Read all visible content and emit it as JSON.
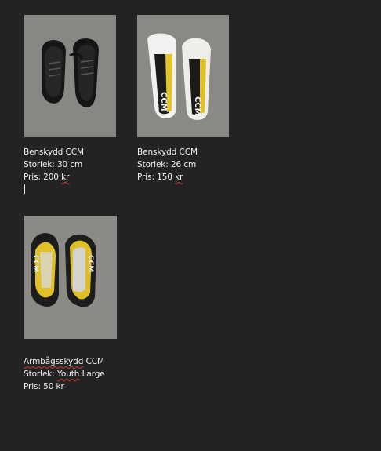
{
  "colors": {
    "page_background": "#232323",
    "text": "#f2f2f2",
    "spellcheck_underline": "#d23b3b"
  },
  "items": [
    {
      "image_subject": "black-ccm-shin-guards-photo",
      "name_word": "Benskydd",
      "name_brand": "CCM",
      "size_prefix": "Storlek:",
      "size_value": "30 cm",
      "price_prefix": "Pris: 200",
      "price_unit": "kr"
    },
    {
      "image_subject": "white-yellow-ccm-shin-guards-photo",
      "name_word": "Benskydd",
      "name_brand": "CCM",
      "size_prefix": "Storlek:",
      "size_value": "26 cm",
      "price_prefix": "Pris: 150",
      "price_unit": "kr"
    },
    {
      "image_subject": "ccm-elbow-pads-photo",
      "name_word": "Armbågsskydd",
      "name_brand": "CCM",
      "size_prefix": "Storlek:",
      "size_value_a": "Youth",
      "size_value_b": "Large",
      "price_prefix": "Pris: 50",
      "price_unit": "kr"
    }
  ]
}
